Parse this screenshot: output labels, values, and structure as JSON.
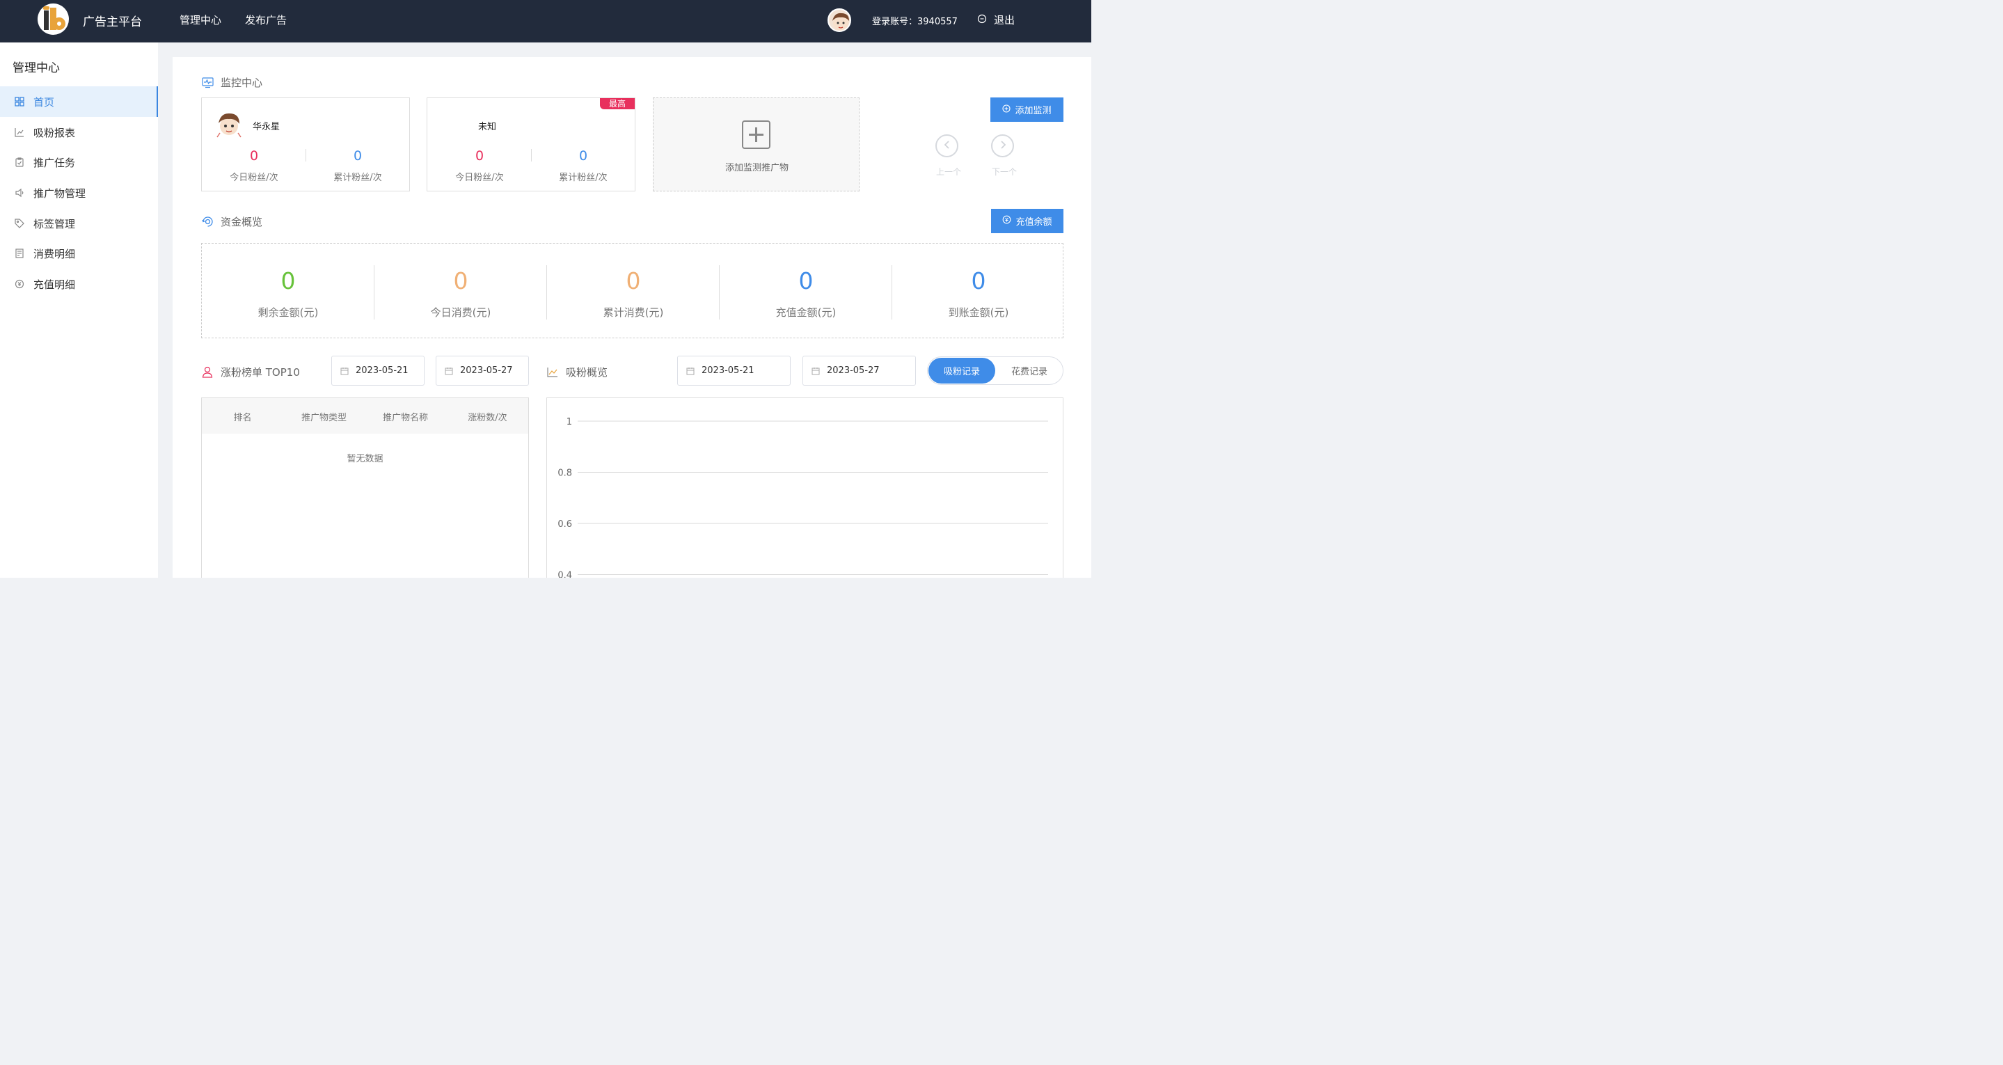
{
  "header": {
    "brand": "广告主平台",
    "nav": [
      "管理中心",
      "发布广告"
    ],
    "account_label": "登录账号：3940557",
    "logout_label": "退出"
  },
  "sidebar": {
    "title": "管理中心",
    "items": [
      {
        "label": "首页",
        "icon": "grid-icon",
        "active": true
      },
      {
        "label": "吸粉报表",
        "icon": "bar-chart-icon"
      },
      {
        "label": "推广任务",
        "icon": "clipboard-icon"
      },
      {
        "label": "推广物管理",
        "icon": "speaker-icon"
      },
      {
        "label": "标签管理",
        "icon": "tag-icon"
      },
      {
        "label": "消费明细",
        "icon": "receipt-icon"
      },
      {
        "label": "充值明细",
        "icon": "coin-icon"
      }
    ]
  },
  "monitor": {
    "title": "监控中心",
    "cards": [
      {
        "name": "华永星",
        "today": "0",
        "today_label": "今日粉丝/次",
        "total": "0",
        "total_label": "累计粉丝/次"
      },
      {
        "name": "未知",
        "badge": "最高",
        "today": "0",
        "today_label": "今日粉丝/次",
        "total": "0",
        "total_label": "累计粉丝/次"
      }
    ],
    "add_label": "添加监测推广物",
    "add_button": "添加监测",
    "prev_label": "上一个",
    "next_label": "下一个"
  },
  "funds": {
    "title": "资金概览",
    "recharge_button": "充值余额",
    "items": [
      {
        "value": "0",
        "label": "剩余金额(元)",
        "color": "#67c23a"
      },
      {
        "value": "0",
        "label": "今日消费(元)",
        "color": "#f0b075"
      },
      {
        "value": "0",
        "label": "累计消费(元)",
        "color": "#f0b075"
      },
      {
        "value": "0",
        "label": "充值金额(元)",
        "color": "#3f8ce8"
      },
      {
        "value": "0",
        "label": "到账金额(元)",
        "color": "#3f8ce8"
      }
    ]
  },
  "ranking": {
    "title": "涨粉榜单 TOP10",
    "start_date": "2023-05-21",
    "end_date": "2023-05-27",
    "columns": [
      "排名",
      "推广物类型",
      "推广物名称",
      "涨粉数/次"
    ],
    "empty_text": "暂无数据"
  },
  "overview": {
    "title": "吸粉概览",
    "start_date": "2023-05-21",
    "end_date": "2023-05-27",
    "tabs": [
      "吸粉记录",
      "花费记录"
    ],
    "active_tab": "吸粉记录"
  },
  "chart_data": {
    "type": "line",
    "ylim": [
      0,
      1
    ],
    "yticks": [
      "1",
      "0.8",
      "0.6",
      "0.4"
    ],
    "series": []
  }
}
